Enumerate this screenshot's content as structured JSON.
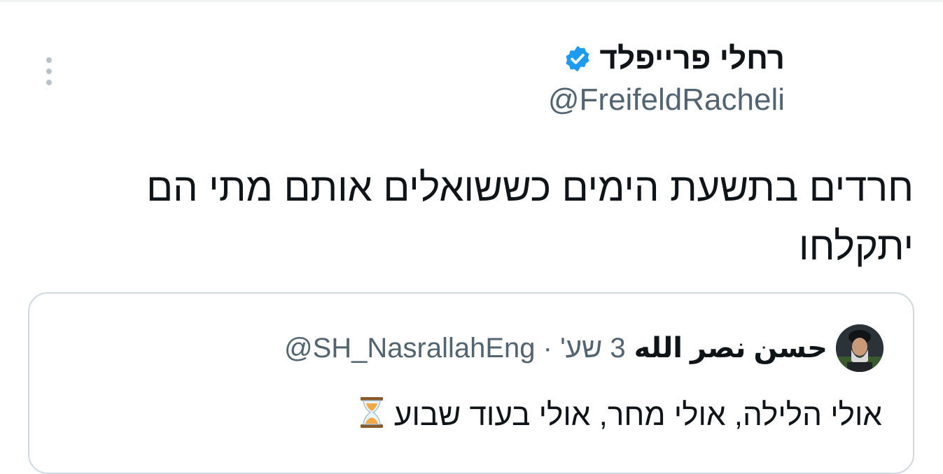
{
  "author": {
    "display_name": "רחלי פרייפלד",
    "handle": "@FreifeldRacheli",
    "verified_icon": "verified-badge-icon"
  },
  "menu": {
    "icon": "more-vertical-icon"
  },
  "tweet": {
    "text": "חרדים בתשעת הימים כששואלים אותם מתי הם יתקלחו"
  },
  "quoted_tweet": {
    "display_name": "حسن نصر الله",
    "handle": "@SH_NasrallahEng",
    "separator": "·",
    "time": "3 שע'",
    "text": "אולי הלילה, אולי מחר, אולי בעוד שבוע",
    "emoji_icon": "hourglass-icon"
  },
  "colors": {
    "text_primary": "#0f1419",
    "text_secondary": "#536471",
    "verified_blue": "#1d9bf0",
    "border": "#cfd9de"
  }
}
